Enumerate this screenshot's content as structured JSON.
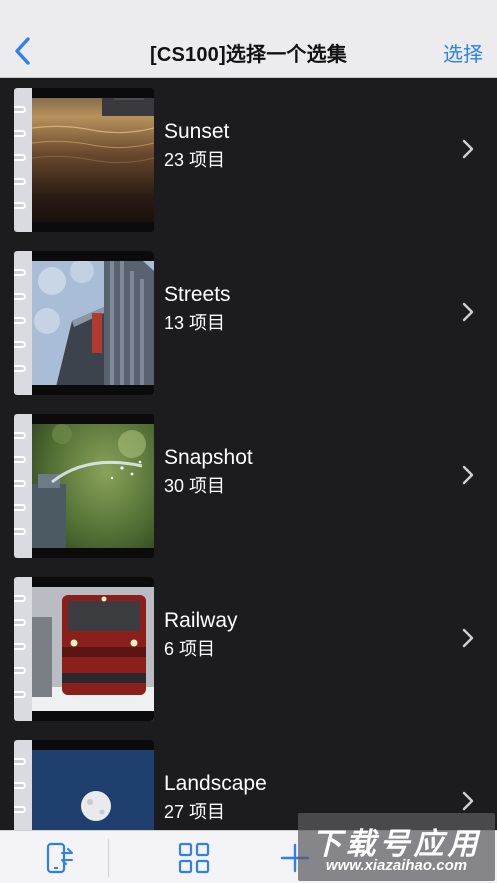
{
  "navbar": {
    "back_icon": "chevron-left-icon",
    "title": "[CS100]选择一个选集",
    "action_label": "选择",
    "accent_color": "#2f7ff0"
  },
  "albums": [
    {
      "title": "Sunset",
      "count": "23 项目",
      "photo": "sunset"
    },
    {
      "title": "Streets",
      "count": "13 项目",
      "photo": "streets"
    },
    {
      "title": "Snapshot",
      "count": "30 项目",
      "photo": "snapshot"
    },
    {
      "title": "Railway",
      "count": "6 项目",
      "photo": "railway"
    },
    {
      "title": "Landscape",
      "count": "27 项目",
      "photo": "landscape"
    }
  ],
  "toolbar": {
    "items": [
      "transfer-icon",
      "grid-icon",
      "add-icon"
    ]
  },
  "watermark": {
    "main": "下载号应用",
    "sub": "www.xiazaihao.com"
  }
}
